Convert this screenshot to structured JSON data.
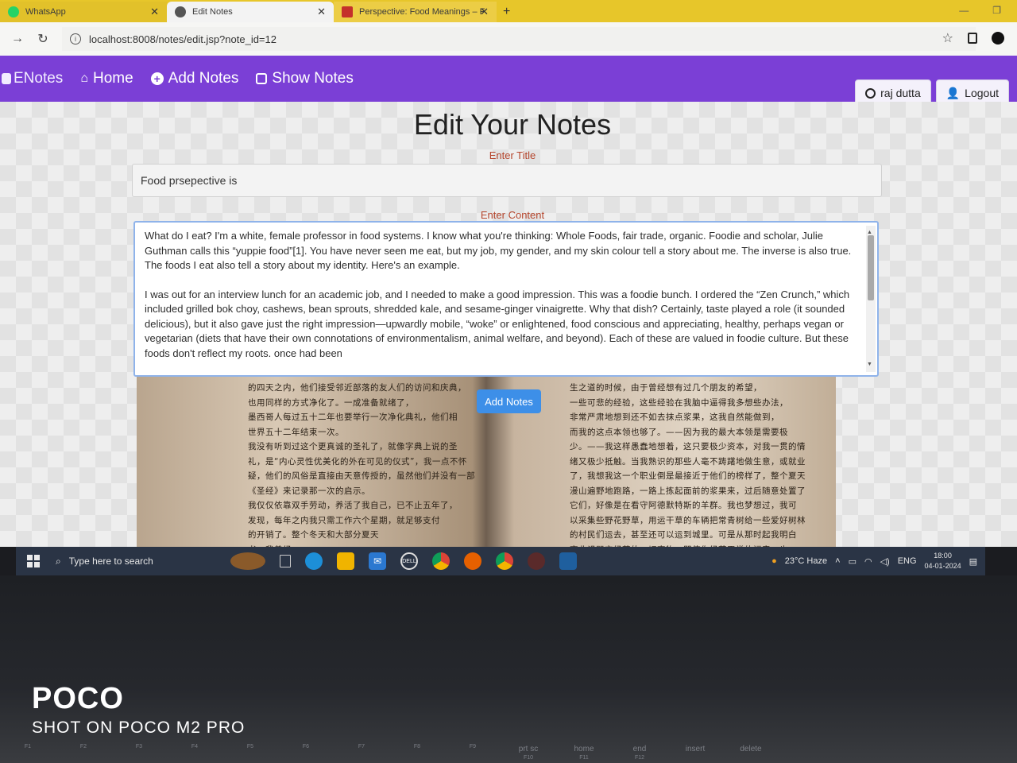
{
  "browser": {
    "tabs": [
      {
        "label": "WhatsApp",
        "icon": "whatsapp-icon"
      },
      {
        "label": "Edit Notes",
        "icon": "globe-icon"
      },
      {
        "label": "Perspective: Food Meanings – F",
        "icon": "pdf-icon"
      }
    ],
    "new_tab": "+",
    "url": "localhost:8008/notes/edit.jsp?note_id=12"
  },
  "app": {
    "brand": "ENotes",
    "nav": {
      "home": "Home",
      "add_notes": "Add Notes",
      "show_notes": "Show Notes"
    },
    "user_button": "raj dutta",
    "logout_button": "Logout",
    "accent_color": "#7b3fd6"
  },
  "form": {
    "heading": "Edit Your Notes",
    "title_label": "Enter Title",
    "title_value": "Food prsepective is",
    "content_label": "Enter Content",
    "content_paragraphs": [
      "What do I eat? I'm a white, female professor in food systems. I know what you're thinking: Whole Foods, fair trade, organic. Foodie and scholar, Julie Guthman calls this “yuppie food”[1]. You have never seen me eat, but my job, my gender, and my skin colour tell a story about me. The inverse is also true. The foods I eat also tell a story about my identity. Here's an example.",
      "I was out for an interview lunch for an academic job, and I needed to make a good impression. This was a foodie bunch. I ordered the “Zen Crunch,” which included grilled bok choy, cashews, bean sprouts, shredded kale, and sesame-ginger vinaigrette. Why that dish? Certainly, taste played a role (it sounded delicious), but it also gave just the right impression—upwardly mobile, “woke” or enlightened, food conscious and appreciating, healthy, perhaps vegan or vegetarian (diets that have their own connotations of environmentalism, animal welfare, and beyond). Each of these are valued in foodie culture. But these foods don't reflect my roots. once had been"
    ],
    "submit_button": "Add Notes",
    "button_color": "#3d8fe8"
  },
  "wallpaper_text": {
    "left": [
      "的四天之内，他们接受邻近部落的友人们的访问和庆典，",
      "也用同样的方式净化了。一成准备就绪了，",
      "墨西哥人每过五十二年也要举行一次净化典礼，他们相",
      "世界五十二年结束一次。",
      "我没有听到过这个更真诚的圣礼了，就像字典上说的圣",
      "礼，是“内心灵性优美化的外在可见的仪式”，我一点不怀",
      "疑，他们的风俗是直接由天意传授的，虽然他们并没有一部",
      "《圣经》来记录那一次的启示。",
      "我仅仅依靠双手劳动，养活了我自己，已不止五年了，",
      "发现，每年之内我只需工作六个星期，就足够支付",
      "的开销了。整个冬天和大部分夏天",
      "书。我曾经"
    ],
    "right": [
      "生之道的时候，由于曾经想有过几个朋友的希望，",
      "一些可悲的经验，这些经验在我脑中逼得我多想些办法，",
      "非常严肃地想到还不如去抹点浆果，这我自然能做到，",
      "而我的这点本领也够了。——因为我的最大本领是需要极",
      "少。——我这样愚蠢地想着，这只要极少资本，对我一贯的情",
      "绪又极少抵触。当我熟识的那些人毫不踌躇地做生意，或就业",
      "了，我想我这一个职业倒是最接近于他们的榜样了，整个夏天",
      "漫山遍野地跑路，一路上拣起面前的浆果来，过后随意处置了",
      "它们，好像是在看守阿德默特斯的羊群。我也梦想过，我可",
      "以采集些野花野草，用运干草的车辆把常青树给一些爱好树林",
      "的村民们运去，甚至还可以运到城里。可是从那时起我明白",
      "商业诅咒它经营的一切事物，即使你经营天堂的福音，也"
    ]
  },
  "taskbar": {
    "search_placeholder": "Type here to search",
    "weather": "23°C  Haze",
    "language": "ENG",
    "time": "18:00",
    "date": "04-01-2024"
  },
  "photo_watermark": {
    "brand": "POCO",
    "caption": "SHOT ON POCO M2 PRO"
  },
  "keyboard_keys": [
    {
      "label": "",
      "sub": "F1"
    },
    {
      "label": "",
      "sub": "F2"
    },
    {
      "label": "",
      "sub": "F3"
    },
    {
      "label": "",
      "sub": "F4"
    },
    {
      "label": "",
      "sub": "F5"
    },
    {
      "label": "",
      "sub": "F6"
    },
    {
      "label": "",
      "sub": "F7"
    },
    {
      "label": "",
      "sub": "F8"
    },
    {
      "label": "",
      "sub": "F9"
    },
    {
      "label": "prt sc",
      "sub": "F10"
    },
    {
      "label": "home",
      "sub": "F11"
    },
    {
      "label": "end",
      "sub": "F12"
    },
    {
      "label": "insert",
      "sub": ""
    },
    {
      "label": "delete",
      "sub": ""
    }
  ]
}
